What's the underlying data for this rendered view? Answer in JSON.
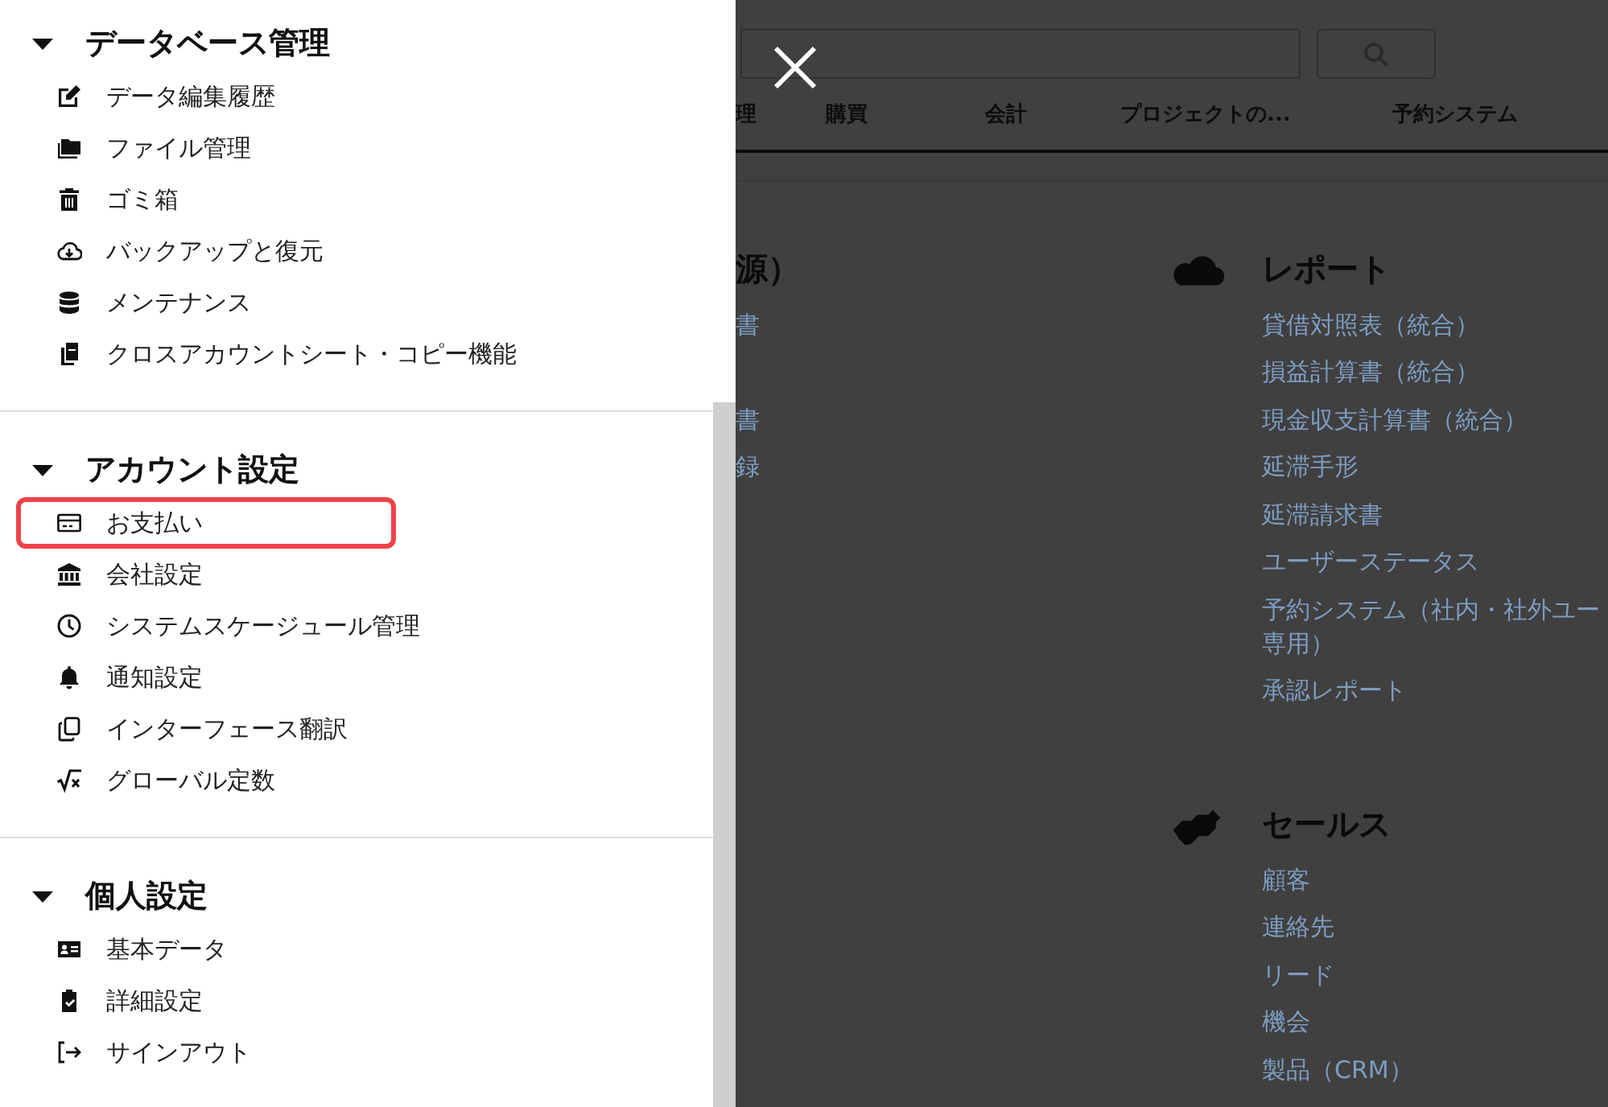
{
  "drawer": {
    "sections": [
      {
        "title": "データベース管理",
        "expanded": true,
        "items": [
          {
            "label": "データ編集履歴",
            "selected": false
          },
          {
            "label": "ファイル管理",
            "selected": false
          },
          {
            "label": "ゴミ箱",
            "selected": false
          },
          {
            "label": "バックアップと復元",
            "selected": false
          },
          {
            "label": "メンテナンス",
            "selected": false
          },
          {
            "label": "クロスアカウントシート・コピー機能",
            "selected": false
          }
        ]
      },
      {
        "title": "アカウント設定",
        "expanded": true,
        "items": [
          {
            "label": "お支払い",
            "selected": true
          },
          {
            "label": "会社設定",
            "selected": false
          },
          {
            "label": "システムスケージュール管理",
            "selected": false
          },
          {
            "label": "通知設定",
            "selected": false
          },
          {
            "label": "インターフェース翻訳",
            "selected": false
          },
          {
            "label": "グローバル定数",
            "selected": false
          }
        ]
      },
      {
        "title": "個人設定",
        "expanded": true,
        "items": [
          {
            "label": "基本データ",
            "selected": false
          },
          {
            "label": "詳細設定",
            "selected": false
          },
          {
            "label": "サインアウト",
            "selected": false
          }
        ]
      }
    ]
  },
  "tabs": [
    {
      "label": "理"
    },
    {
      "label": "購買"
    },
    {
      "label": "会計"
    },
    {
      "label": "プロジェクトの..."
    },
    {
      "label": "予約システム"
    }
  ],
  "content": {
    "left_column": {
      "title": "源）",
      "links": [
        {
          "text": "書"
        },
        {
          "text": "書"
        },
        {
          "text": "録"
        }
      ]
    },
    "right_column": [
      {
        "title": "レポート",
        "links": [
          {
            "text": "貸借対照表（統合）"
          },
          {
            "text": "損益計算書（統合）"
          },
          {
            "text": "現金収支計算書（統合）"
          },
          {
            "text": "延滞手形"
          },
          {
            "text": "延滞請求書"
          },
          {
            "text": "ユーザーステータス"
          },
          {
            "lines": [
              "予約システム（社内・社外ユー",
              "専用）"
            ]
          },
          {
            "text": "承認レポート"
          }
        ]
      },
      {
        "title": "セールス",
        "links": [
          {
            "text": "顧客"
          },
          {
            "text": "連絡先"
          },
          {
            "text": "リード"
          },
          {
            "text": "機会"
          },
          {
            "text": "製品（CRM）"
          }
        ]
      }
    ]
  }
}
